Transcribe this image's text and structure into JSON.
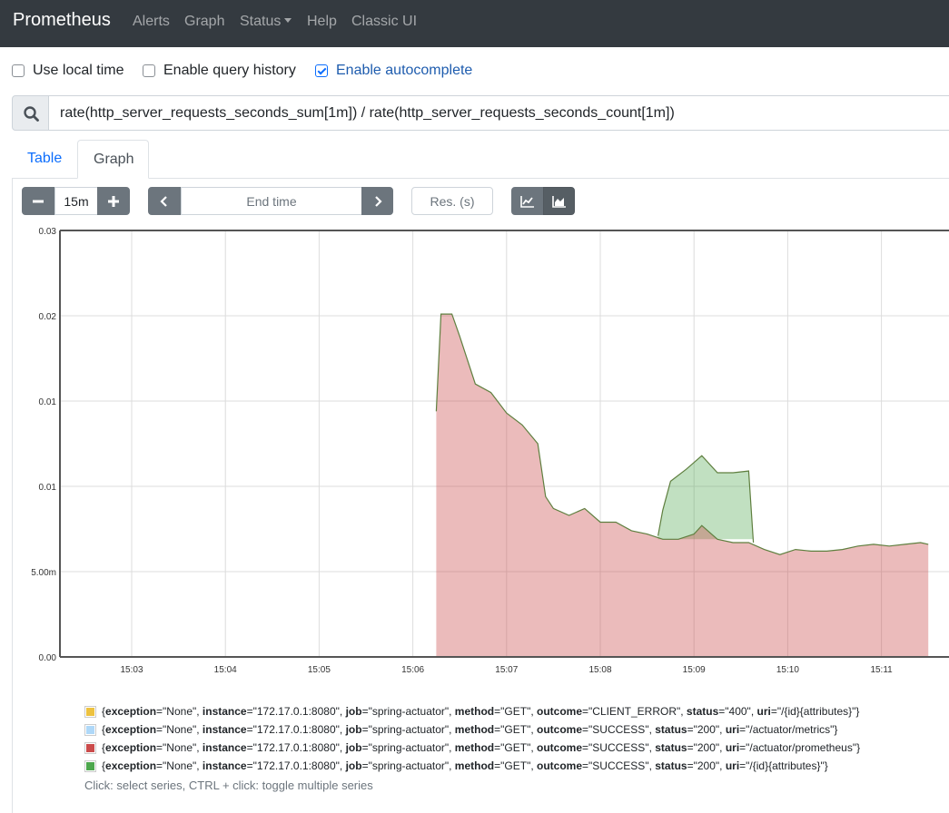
{
  "navbar": {
    "brand": "Prometheus",
    "links": [
      "Alerts",
      "Graph",
      "Status",
      "Help",
      "Classic UI"
    ]
  },
  "options": {
    "local_time": {
      "label": "Use local time",
      "checked": false
    },
    "query_history": {
      "label": "Enable query history",
      "checked": false
    },
    "autocomplete": {
      "label": "Enable autocomplete",
      "checked": true
    }
  },
  "expression": "rate(http_server_requests_seconds_sum[1m]) / rate(http_server_requests_seconds_count[1m])",
  "tabs": {
    "table": "Table",
    "graph": "Graph"
  },
  "controls": {
    "range": "15m",
    "end_time_placeholder": "End time",
    "resolution_placeholder": "Res. (s)"
  },
  "colors": {
    "brand_bg": "#343a40",
    "series_1": "#edc240",
    "series_2": "#afd8f8",
    "series_3": "#cb4b4b",
    "series_4": "#4da74d"
  },
  "chart_data": {
    "type": "area",
    "stacked": true,
    "y_tick_labels": [
      "0.00",
      "5.00m",
      "0.01",
      "0.01",
      "0.02",
      "0.03"
    ],
    "x_tick_labels": [
      "15:03",
      "15:04",
      "15:05",
      "15:06",
      "15:07",
      "15:08",
      "15:09",
      "15:10",
      "15:11"
    ],
    "ylim": [
      0,
      0.025
    ],
    "grid": true,
    "series": [
      {
        "name": "{exception=\"None\", instance=\"172.17.0.1:8080\", job=\"spring-actuator\", method=\"GET\", outcome=\"SUCCESS\", status=\"200\", uri=\"/actuator/prometheus\"}",
        "color": "#cb4b4b",
        "points": [
          [
            "15:06:15",
            0.0144
          ],
          [
            "15:06:18",
            0.0201
          ],
          [
            "15:06:25",
            0.0201
          ],
          [
            "15:06:30",
            0.0188
          ],
          [
            "15:06:40",
            0.016
          ],
          [
            "15:06:50",
            0.0155
          ],
          [
            "15:07:00",
            0.0143
          ],
          [
            "15:07:10",
            0.0136
          ],
          [
            "15:07:20",
            0.0125
          ],
          [
            "15:07:25",
            0.0094
          ],
          [
            "15:07:30",
            0.0087
          ],
          [
            "15:07:40",
            0.0083
          ],
          [
            "15:07:50",
            0.0087
          ],
          [
            "15:08:00",
            0.0079
          ],
          [
            "15:08:10",
            0.0079
          ],
          [
            "15:08:20",
            0.0074
          ],
          [
            "15:08:30",
            0.0072
          ],
          [
            "15:08:40",
            0.0069
          ],
          [
            "15:08:50",
            0.0069
          ],
          [
            "15:09:00",
            0.0072
          ],
          [
            "15:09:05",
            0.0077
          ],
          [
            "15:09:15",
            0.0069
          ],
          [
            "15:09:25",
            0.0067
          ],
          [
            "15:09:35",
            0.0067
          ],
          [
            "15:09:45",
            0.0063
          ],
          [
            "15:09:55",
            0.006
          ],
          [
            "15:10:05",
            0.0063
          ],
          [
            "15:10:15",
            0.0062
          ],
          [
            "15:10:25",
            0.0062
          ],
          [
            "15:10:35",
            0.0063
          ],
          [
            "15:10:45",
            0.0065
          ],
          [
            "15:10:55",
            0.0066
          ],
          [
            "15:11:05",
            0.0065
          ],
          [
            "15:11:15",
            0.0066
          ],
          [
            "15:11:25",
            0.0067
          ],
          [
            "15:11:30",
            0.0066
          ]
        ]
      },
      {
        "name": "{exception=\"None\", instance=\"172.17.0.1:8080\", job=\"spring-actuator\", method=\"GET\", outcome=\"SUCCESS\", status=\"200\", uri=\"/{id}{attributes}\"}",
        "color": "#4da74d",
        "points": [
          [
            "15:08:37",
            0.0071
          ],
          [
            "15:08:40",
            0.0086
          ],
          [
            "15:08:45",
            0.0103
          ],
          [
            "15:08:55",
            0.011
          ],
          [
            "15:09:05",
            0.0118
          ],
          [
            "15:09:15",
            0.0108
          ],
          [
            "15:09:25",
            0.0108
          ],
          [
            "15:09:35",
            0.0109
          ],
          [
            "15:09:38",
            0.0067
          ]
        ]
      }
    ]
  },
  "legend": [
    {
      "color": "#edc240",
      "labels": [
        [
          "exception",
          "None"
        ],
        [
          "instance",
          "172.17.0.1:8080"
        ],
        [
          "job",
          "spring-actuator"
        ],
        [
          "method",
          "GET"
        ],
        [
          "outcome",
          "CLIENT_ERROR"
        ],
        [
          "status",
          "400"
        ],
        [
          "uri",
          "/{id}{attributes}"
        ]
      ]
    },
    {
      "color": "#afd8f8",
      "labels": [
        [
          "exception",
          "None"
        ],
        [
          "instance",
          "172.17.0.1:8080"
        ],
        [
          "job",
          "spring-actuator"
        ],
        [
          "method",
          "GET"
        ],
        [
          "outcome",
          "SUCCESS"
        ],
        [
          "status",
          "200"
        ],
        [
          "uri",
          "/actuator/metrics"
        ]
      ]
    },
    {
      "color": "#cb4b4b",
      "labels": [
        [
          "exception",
          "None"
        ],
        [
          "instance",
          "172.17.0.1:8080"
        ],
        [
          "job",
          "spring-actuator"
        ],
        [
          "method",
          "GET"
        ],
        [
          "outcome",
          "SUCCESS"
        ],
        [
          "status",
          "200"
        ],
        [
          "uri",
          "/actuator/prometheus"
        ]
      ]
    },
    {
      "color": "#4da74d",
      "labels": [
        [
          "exception",
          "None"
        ],
        [
          "instance",
          "172.17.0.1:8080"
        ],
        [
          "job",
          "spring-actuator"
        ],
        [
          "method",
          "GET"
        ],
        [
          "outcome",
          "SUCCESS"
        ],
        [
          "status",
          "200"
        ],
        [
          "uri",
          "/{id}{attributes}"
        ]
      ]
    }
  ],
  "legend_hint": "Click: select series, CTRL + click: toggle multiple series"
}
